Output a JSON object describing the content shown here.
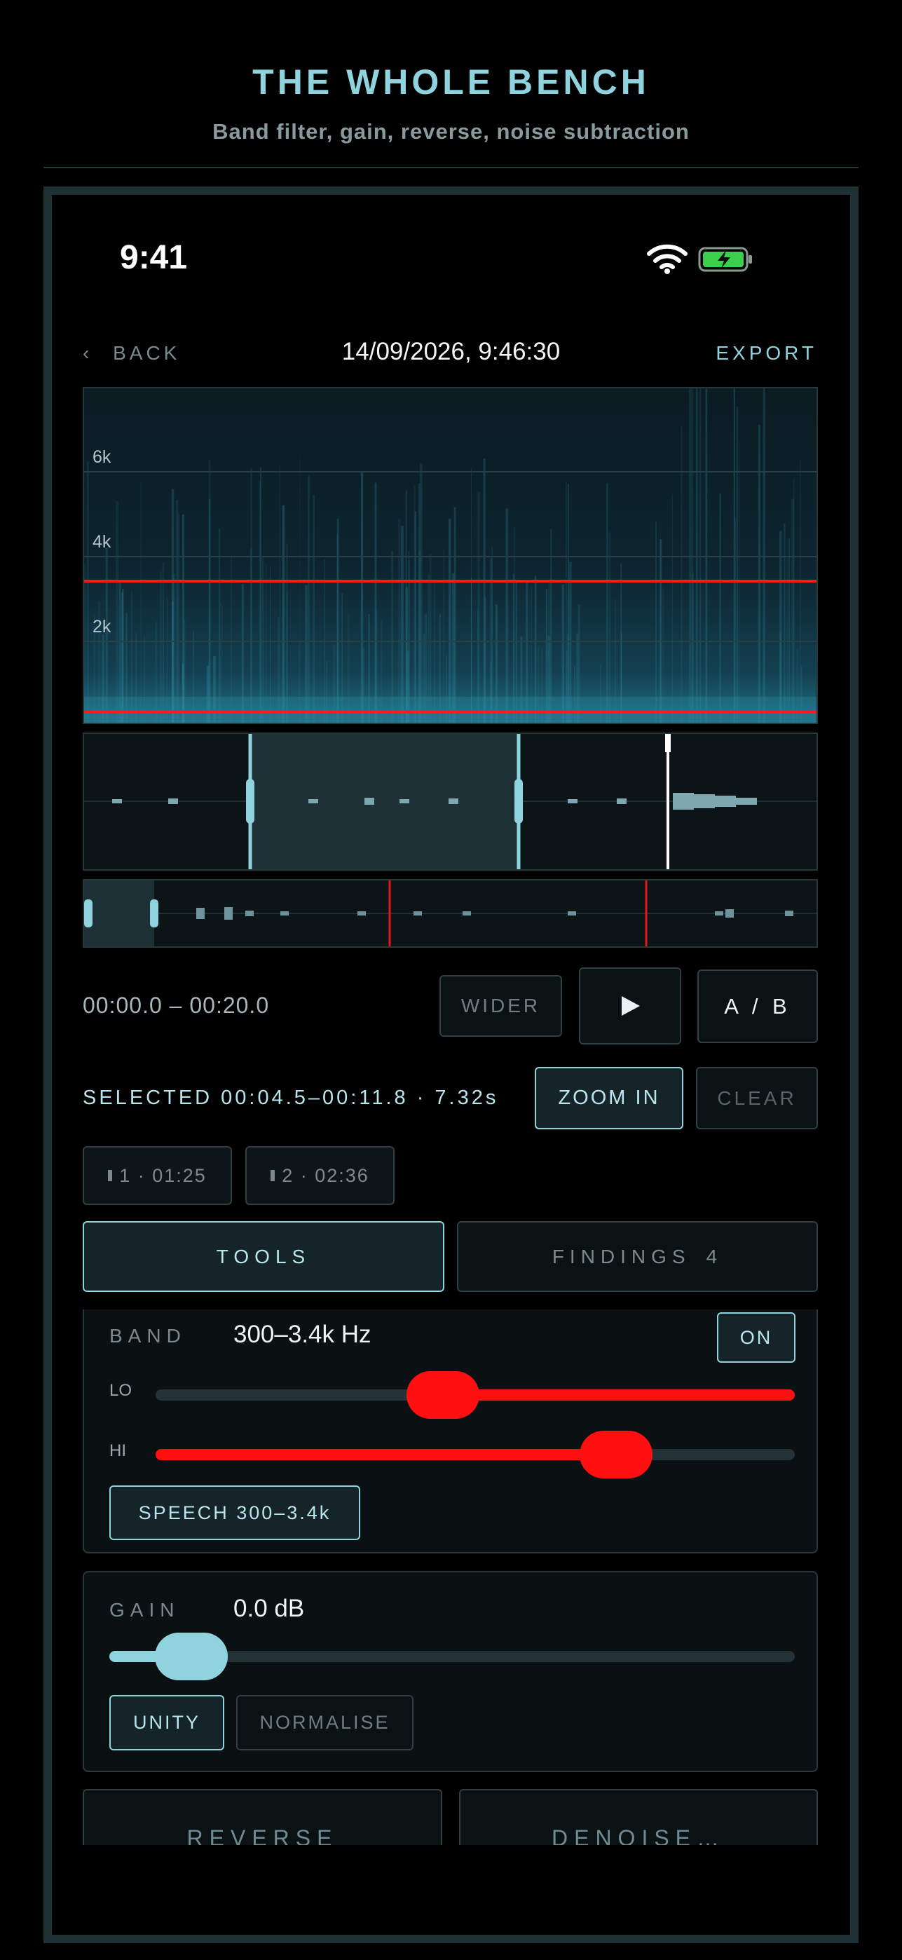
{
  "header": {
    "title": "THE WHOLE BENCH",
    "subtitle": "Band filter, gain, reverse, noise subtraction"
  },
  "status_bar": {
    "time": "9:41",
    "wifi_icon": "wifi-icon",
    "battery_icon": "battery-charging-icon"
  },
  "nav": {
    "back": "BACK",
    "back_icon": "chevron-left-icon",
    "title": "14/09/2026, 9:46:30",
    "export": "EXPORT"
  },
  "spectrogram": {
    "freq_labels": [
      "6k",
      "4k",
      "2k"
    ],
    "band_low_hz": 300,
    "band_high_hz": 3400,
    "band_line_color": "#ff1a1a"
  },
  "waveform": {
    "selection_start": "00:04.5",
    "selection_end": "00:11.8",
    "playhead_color": "#ffffff"
  },
  "transport": {
    "range": "00:00.0 – 00:20.0",
    "wider": "WIDER",
    "play_icon": "play-icon",
    "ab": "A / B"
  },
  "selection": {
    "text": "SELECTED 00:04.5–00:11.8 · 7.32s",
    "zoom_in": "ZOOM IN",
    "clear": "CLEAR"
  },
  "bookmarks": [
    {
      "label": "1 · 01:25"
    },
    {
      "label": "2 · 02:36"
    }
  ],
  "tabs": {
    "tools": "TOOLS",
    "findings": "FINDINGS",
    "findings_count": "4"
  },
  "band": {
    "label": "BAND",
    "value": "300–3.4k Hz",
    "toggle": "ON",
    "lo_label": "LO",
    "hi_label": "HI",
    "lo_fraction": 0.45,
    "hi_fraction": 0.72,
    "preset": "SPEECH 300–3.4k",
    "accent": "#ff0f0f"
  },
  "gain": {
    "label": "GAIN",
    "value": "0.0 dB",
    "fraction": 0.12,
    "unity": "UNITY",
    "normalise": "NORMALISE",
    "accent": "#8fd3df"
  },
  "actions": {
    "reverse": "REVERSE",
    "denoise": "DENOISE…"
  }
}
